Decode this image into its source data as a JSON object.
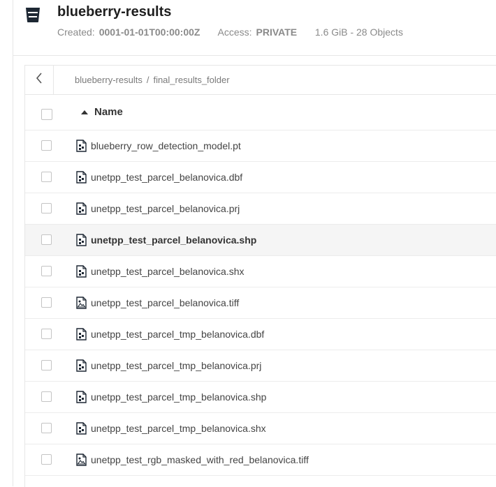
{
  "bucket": {
    "title": "blueberry-results",
    "created_label": "Created:",
    "created_value": "0001-01-01T00:00:00Z",
    "access_label": "Access:",
    "access_value": "PRIVATE",
    "size_summary": "1.6 GiB - 28 Objects"
  },
  "breadcrumb": {
    "items": [
      "blueberry-results",
      "final_results_folder"
    ],
    "separator": "/"
  },
  "table": {
    "sort_column": "Name",
    "files": [
      {
        "name": "blueberry_row_detection_model.pt",
        "icon": "file-icon"
      },
      {
        "name": "unetpp_test_parcel_belanovica.dbf",
        "icon": "file-icon"
      },
      {
        "name": "unetpp_test_parcel_belanovica.prj",
        "icon": "file-icon"
      },
      {
        "name": "unetpp_test_parcel_belanovica.shp",
        "icon": "file-icon"
      },
      {
        "name": "unetpp_test_parcel_belanovica.shx",
        "icon": "file-icon"
      },
      {
        "name": "unetpp_test_parcel_belanovica.tiff",
        "icon": "image-file-icon"
      },
      {
        "name": "unetpp_test_parcel_tmp_belanovica.dbf",
        "icon": "file-icon"
      },
      {
        "name": "unetpp_test_parcel_tmp_belanovica.prj",
        "icon": "file-icon"
      },
      {
        "name": "unetpp_test_parcel_tmp_belanovica.shp",
        "icon": "file-icon"
      },
      {
        "name": "unetpp_test_parcel_tmp_belanovica.shx",
        "icon": "file-icon"
      },
      {
        "name": "unetpp_test_rgb_masked_with_red_belanovica.tiff",
        "icon": "image-file-icon"
      }
    ]
  },
  "colors": {
    "border": "#e6e6e6",
    "hover_row": "#f5f5f5",
    "icon_dark": "#1d2733"
  }
}
